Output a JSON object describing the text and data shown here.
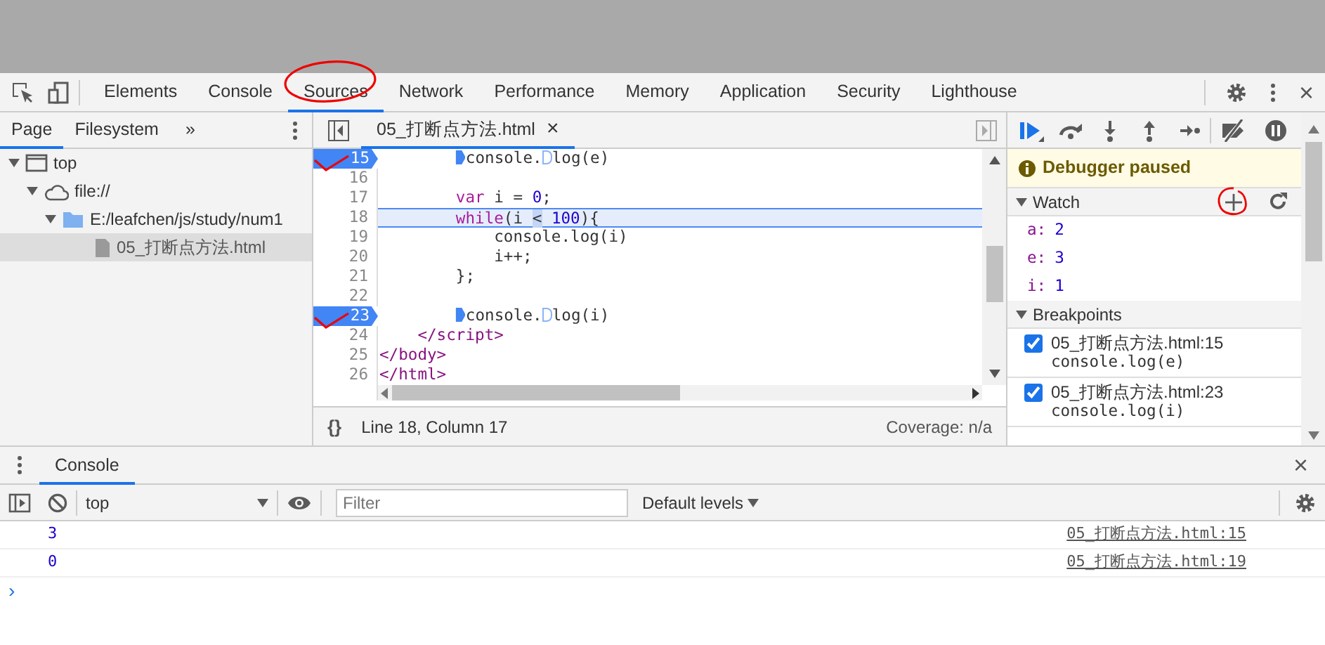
{
  "main_tabs": [
    {
      "label": "Elements",
      "selected": false,
      "annotated": false
    },
    {
      "label": "Console",
      "selected": false,
      "annotated": false
    },
    {
      "label": "Sources",
      "selected": true,
      "annotated": true
    },
    {
      "label": "Network",
      "selected": false,
      "annotated": false
    },
    {
      "label": "Performance",
      "selected": false,
      "annotated": false
    },
    {
      "label": "Memory",
      "selected": false,
      "annotated": false
    },
    {
      "label": "Application",
      "selected": false,
      "annotated": false
    },
    {
      "label": "Security",
      "selected": false,
      "annotated": false
    },
    {
      "label": "Lighthouse",
      "selected": false,
      "annotated": false
    }
  ],
  "close_devtools": "×",
  "navigator": {
    "tabs": [
      {
        "label": "Page",
        "selected": true
      },
      {
        "label": "Filesystem",
        "selected": false
      }
    ],
    "more": "»",
    "tree": [
      {
        "label": "top",
        "kind": "frame",
        "expanded": true,
        "selected": false,
        "children": [
          {
            "label": "file://",
            "kind": "origin",
            "expanded": true,
            "selected": false,
            "children": [
              {
                "label": "E:/leafchen/js/study/num1",
                "kind": "folder",
                "expanded": true,
                "selected": false,
                "children": [
                  {
                    "label": "05_打断点方法.html",
                    "kind": "file",
                    "selected": true
                  }
                ]
              }
            ]
          }
        ]
      }
    ]
  },
  "editor": {
    "tab": {
      "label": "05_打断点方法.html",
      "close": "×"
    },
    "lines": [
      {
        "number": "15",
        "breakpoint": true,
        "current": false,
        "annotated": true,
        "tokens": [
          {
            "kind": "plain",
            "text": "        console.",
            "inline_breakpoint": true,
            "active": true
          },
          {
            "kind": "plain",
            "text": "log(e)",
            "inline_breakpoint": true,
            "active": false
          }
        ]
      },
      {
        "number": "16",
        "breakpoint": false,
        "current": false,
        "annotated": false
      },
      {
        "number": "17",
        "breakpoint": false,
        "current": false,
        "annotated": false,
        "tokens": [
          {
            "kind": "keyword",
            "text": "        var"
          },
          {
            "kind": "plain",
            "text": " i = "
          },
          {
            "kind": "number",
            "text": "0"
          },
          {
            "kind": "plain",
            "text": ";"
          }
        ]
      },
      {
        "number": "18",
        "breakpoint": false,
        "current": true,
        "annotated": false,
        "tokens": [
          {
            "kind": "keyword",
            "text": "        while"
          },
          {
            "kind": "plain",
            "text": "(i "
          },
          {
            "kind": "highlight",
            "text": "<"
          },
          {
            "kind": "number",
            "text": " 100"
          },
          {
            "kind": "plain",
            "text": "){"
          }
        ]
      },
      {
        "number": "19",
        "breakpoint": false,
        "current": false,
        "annotated": false,
        "tokens": [
          {
            "kind": "plain",
            "text": "            console.log(i)"
          }
        ]
      },
      {
        "number": "20",
        "breakpoint": false,
        "current": false,
        "annotated": false,
        "tokens": [
          {
            "kind": "plain",
            "text": "            i++;"
          }
        ]
      },
      {
        "number": "21",
        "breakpoint": false,
        "current": false,
        "annotated": false,
        "tokens": [
          {
            "kind": "plain",
            "text": "        };"
          }
        ]
      },
      {
        "number": "22",
        "breakpoint": false,
        "current": false,
        "annotated": false
      },
      {
        "number": "23",
        "breakpoint": true,
        "current": false,
        "annotated": true,
        "tokens": [
          {
            "kind": "plain",
            "text": "        console.",
            "inline_breakpoint": true,
            "active": true
          },
          {
            "kind": "plain",
            "text": "log(i)",
            "inline_breakpoint": true,
            "active": false
          }
        ]
      },
      {
        "number": "24",
        "breakpoint": false,
        "current": false,
        "annotated": false,
        "tokens": [
          {
            "kind": "tag",
            "text": "    </script>"
          }
        ]
      },
      {
        "number": "25",
        "breakpoint": false,
        "current": false,
        "annotated": false,
        "tokens": [
          {
            "kind": "tag",
            "text": "</body>"
          }
        ]
      },
      {
        "number": "26",
        "breakpoint": false,
        "current": false,
        "annotated": false,
        "tokens": [
          {
            "kind": "tag",
            "text": "</html>"
          }
        ]
      }
    ],
    "format_button": "{}",
    "position": "Line 18, Column 17",
    "coverage": "Coverage: n/a"
  },
  "debugger": {
    "paused_message": "Debugger paused",
    "watch": {
      "title": "Watch",
      "expanded": true,
      "add_annotated": true,
      "items": [
        {
          "name": "a:",
          "value": "2"
        },
        {
          "name": "e:",
          "value": "3"
        },
        {
          "name": "i:",
          "value": "1"
        }
      ]
    },
    "breakpoints": {
      "title": "Breakpoints",
      "expanded": true,
      "items": [
        {
          "file": "05_打断点方法.html:15",
          "code": "console.log(e)",
          "checked": true
        },
        {
          "file": "05_打断点方法.html:23",
          "code": "console.log(i)",
          "checked": true
        }
      ]
    }
  },
  "drawer": {
    "tabs": [
      {
        "label": "Console",
        "selected": true
      }
    ],
    "close": "×",
    "context": "top",
    "filter_placeholder": "Filter",
    "levels": "Default levels",
    "messages": [
      {
        "text": "3",
        "source": "05_打断点方法.html:15"
      },
      {
        "text": "0",
        "source": "05_打断点方法.html:19"
      }
    ],
    "prompt": "›"
  }
}
